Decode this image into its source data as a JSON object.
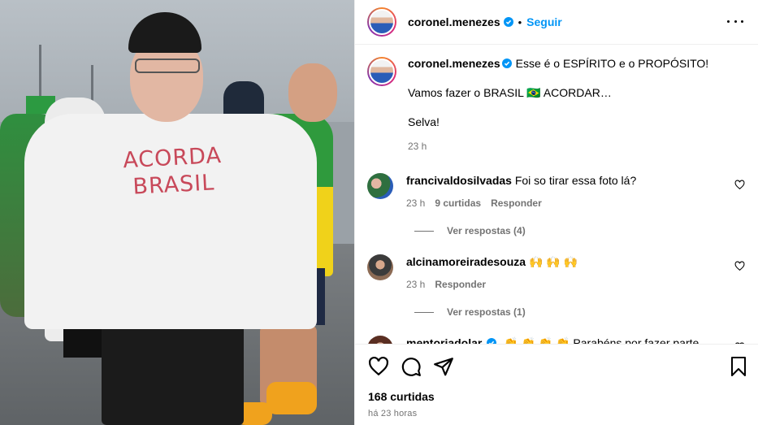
{
  "post": {
    "author": "coronel.menezes",
    "follow_label": "Seguir",
    "shirt_text_line1": "ACORDA",
    "shirt_text_line2": "BRASIL"
  },
  "caption": {
    "author": "coronel.menezes",
    "line1": "Esse é o ESPÍRITO e o PROPÓSITO!",
    "line2": "Vamos fazer o BRASIL 🇧🇷 ACORDAR…",
    "line3": "Selva!",
    "time": "23 h"
  },
  "comments": [
    {
      "author": "francivaldosilvadas",
      "text": "Foi so tirar essa foto lá?",
      "time": "23 h",
      "likes": "9 curtidas",
      "reply_label": "Responder",
      "view_replies": "Ver respostas (4)"
    },
    {
      "author": "alcinamoreiradesouza",
      "text": "🙌 🙌 🙌",
      "time": "23 h",
      "reply_label": "Responder",
      "view_replies": "Ver respostas (1)"
    },
    {
      "author": "mentoriadolar",
      "text": "👏 👏 👏 👏 Parabéns por fazer parte deste"
    }
  ],
  "footer": {
    "likes": "168 curtidas",
    "posted": "há 23 horas"
  },
  "icons": {
    "verified": "verified-badge-icon",
    "more": "more-options-icon",
    "like": "heart-icon",
    "comment": "comment-bubble-icon",
    "share": "paper-plane-icon",
    "save": "bookmark-icon"
  },
  "colors": {
    "accent": "#0095f6",
    "muted": "#737373",
    "border": "#efefef"
  }
}
